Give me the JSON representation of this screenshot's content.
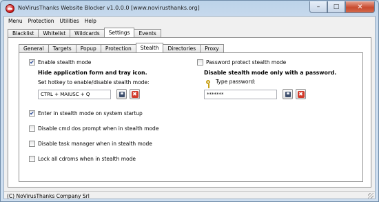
{
  "window": {
    "title": "NoVirusThanks Website Blocker v1.0.0.0 [www.novirusthanks.org]"
  },
  "menu": [
    "Menu",
    "Protection",
    "Utilities",
    "Help"
  ],
  "top_tabs": [
    "Blacklist",
    "Whitelist",
    "Wildcards",
    "Settings",
    "Events"
  ],
  "top_tab_active": "Settings",
  "settings_tabs": [
    "General",
    "Targets",
    "Popup",
    "Protection",
    "Stealth",
    "Directories",
    "Proxy"
  ],
  "settings_tab_active": "Stealth",
  "stealth": {
    "enable_label": "Enable stealth mode",
    "enable_checked": true,
    "hide_info": "Hide application form and tray icon.",
    "hotkey_label": "Set hotkey to enable/disable stealth mode:",
    "hotkey_value": "CTRL + MAIUSC + Q",
    "startup_label": "Enter in stealth mode on system startup",
    "startup_checked": true,
    "disable_cmd_label": "Disable cmd dos prompt when in stealth mode",
    "disable_cmd_checked": false,
    "disable_taskmgr_label": "Disable task manager when in stealth mode",
    "disable_taskmgr_checked": false,
    "lock_cdrom_label": "Lock all cdroms when in stealth mode",
    "lock_cdrom_checked": false,
    "password_protect_label": "Password protect stealth mode",
    "password_protect_checked": false,
    "password_info": "Disable stealth mode only with a password.",
    "type_password_label": "Type password:",
    "password_value": "*******"
  },
  "status": {
    "text": "(C) NoVirusThanks Company Srl"
  },
  "icons": {
    "app": "app-shield-icon",
    "save": "save-icon",
    "delete": "delete-icon",
    "key": "key-icon",
    "check": "✔",
    "x": "✖"
  },
  "colors": {
    "titlebar": "#c7d9ec",
    "close_button": "#c84b2f",
    "delete_red": "#d23b2b",
    "check_blue": "#1c3f94"
  }
}
